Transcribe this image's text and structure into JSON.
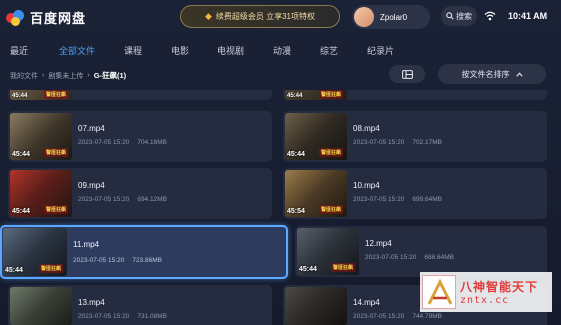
{
  "header": {
    "app_name": "百度网盘",
    "vip_promo": "续费超级会员 立享31项特权",
    "username": "Zpolar0",
    "search_label": "搜索",
    "time": "10:41 AM"
  },
  "tabs": [
    {
      "label": "最近",
      "active": false
    },
    {
      "label": "全部文件",
      "active": true
    },
    {
      "label": "课程",
      "active": false
    },
    {
      "label": "电影",
      "active": false
    },
    {
      "label": "电视剧",
      "active": false
    },
    {
      "label": "动漫",
      "active": false
    },
    {
      "label": "综艺",
      "active": false
    },
    {
      "label": "纪录片",
      "active": false
    }
  ],
  "breadcrumb": {
    "items": [
      "我的文件",
      "剧集未上传"
    ],
    "separator": "›",
    "current": "G-狂飙(1)"
  },
  "toolbar": {
    "sort_label": "按文件名排序",
    "grid_icon": "grid-view-icon",
    "sort_icon": "chevron-up-icon"
  },
  "files": [
    {
      "name": "07.mp4",
      "date": "2023-07-05 15:20",
      "size": "704.18MB",
      "duration": "45:44",
      "tag": "警匪狂飙"
    },
    {
      "name": "08.mp4",
      "date": "2023-07-05 15:20",
      "size": "702.17MB",
      "duration": "45:44",
      "tag": "警匪狂飙"
    },
    {
      "name": "09.mp4",
      "date": "2023-07-05 15:20",
      "size": "694.12MB",
      "duration": "45:44",
      "tag": "警匪狂飙"
    },
    {
      "name": "10.mp4",
      "date": "2023-07-05 15:20",
      "size": "699.64MB",
      "duration": "45:54",
      "tag": "警匪狂飙"
    },
    {
      "name": "11.mp4",
      "date": "2023-07-05 15:20",
      "size": "723.86MB",
      "duration": "45:44",
      "tag": "警匪狂飙",
      "focused": true
    },
    {
      "name": "12.mp4",
      "date": "2023-07-05 15:20",
      "size": "688.64MB",
      "duration": "45:44",
      "tag": "警匪狂飙"
    },
    {
      "name": "13.mp4",
      "date": "2023-07-05 15:20",
      "size": "731.08MB",
      "duration": "",
      "tag": ""
    },
    {
      "name": "14.mp4",
      "date": "2023-07-05 15:20",
      "size": "744.78MB",
      "duration": "",
      "tag": ""
    }
  ],
  "partial_rows": [
    {
      "duration": "45:44",
      "tag": "警匪狂飙"
    },
    {
      "duration": "45:44",
      "tag": "警匪狂飙"
    }
  ],
  "watermark": {
    "line1": "八神智能天下",
    "line2": "zntx.cc"
  },
  "colors": {
    "accent": "#4b9cff",
    "focus_border": "#5aa8ff",
    "background": "#1b2236",
    "card": "#252c40",
    "vip_gold": "#f3dca4",
    "watermark_red": "#e23b3b"
  }
}
